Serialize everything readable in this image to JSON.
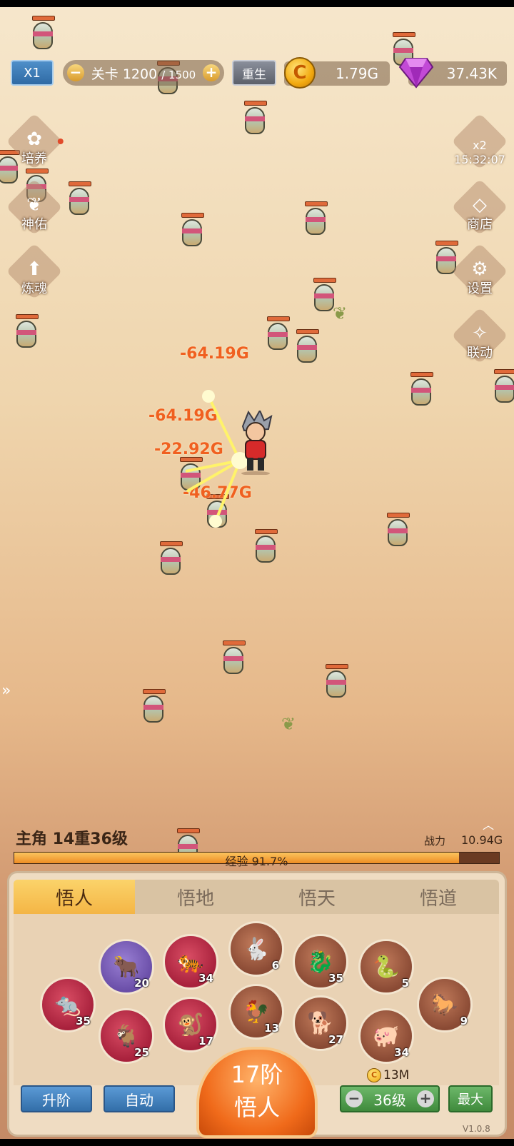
{
  "hud": {
    "speed": "X1",
    "stage_label": "关卡",
    "stage_current": "1200",
    "stage_max": "/ 1500",
    "minus": "−",
    "plus": "+",
    "rebirth": "重生",
    "coin_symbol": "C",
    "gold": "1.79G",
    "gems": "37.43K"
  },
  "left_menu": [
    {
      "label": "培养",
      "icon": "seedling-icon",
      "glyph": "✿"
    },
    {
      "label": "神佑",
      "icon": "hands-icon",
      "glyph": "❦"
    },
    {
      "label": "炼魂",
      "icon": "arrow-up-icon",
      "glyph": "⬆"
    }
  ],
  "right_menu": {
    "boost_badge": "x2",
    "boost_timer": "15:32:07",
    "shop": "商店",
    "settings": "设置",
    "collab": "联动"
  },
  "damage_numbers": [
    "-64.19G",
    "-64.19G",
    "-22.92G",
    "-46.77G"
  ],
  "hero": {
    "name_level": "主角 14重36级",
    "power_label": "战力",
    "power_value": "10.94G",
    "exp_label": "经验 91.7%",
    "exp_fraction": 0.917
  },
  "tabs": [
    "悟人",
    "悟地",
    "悟天",
    "悟道"
  ],
  "active_tab": 0,
  "zodiacs": [
    {
      "name": "rat",
      "glyph": "🐀",
      "level": "35",
      "color": "red"
    },
    {
      "name": "ox",
      "glyph": "🐂",
      "level": "20",
      "color": "purple"
    },
    {
      "name": "goat",
      "glyph": "🐐",
      "level": "25",
      "color": "red"
    },
    {
      "name": "tiger",
      "glyph": "🐅",
      "level": "34",
      "color": "red"
    },
    {
      "name": "monkey",
      "glyph": "🐒",
      "level": "17",
      "color": "red"
    },
    {
      "name": "rabbit",
      "glyph": "🐇",
      "level": "6",
      "color": "brown"
    },
    {
      "name": "rooster",
      "glyph": "🐓",
      "level": "13",
      "color": "brown"
    },
    {
      "name": "dragon",
      "glyph": "🐉",
      "level": "35",
      "color": "brown"
    },
    {
      "name": "dog",
      "glyph": "🐕",
      "level": "27",
      "color": "brown"
    },
    {
      "name": "snake",
      "glyph": "🐍",
      "level": "5",
      "color": "brown"
    },
    {
      "name": "pig",
      "glyph": "🐖",
      "level": "34",
      "color": "brown"
    },
    {
      "name": "horse",
      "glyph": "🐎",
      "level": "9",
      "color": "brown"
    }
  ],
  "controls": {
    "upgrade": "升阶",
    "auto": "自动",
    "rank_line1": "17阶",
    "rank_line2": "悟人",
    "cost": "13M",
    "level": "36级",
    "max": "最大"
  },
  "version": "V1.0.8",
  "colors": {
    "accent": "#f06a1a",
    "damage": "#f06020",
    "exp": "#ee8d24"
  }
}
